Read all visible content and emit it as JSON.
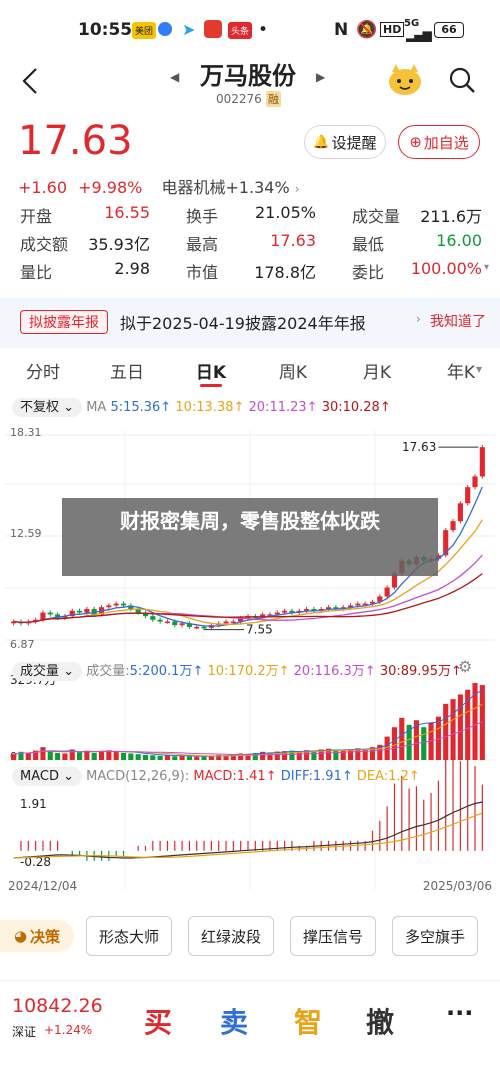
{
  "status_bar": {
    "time": "10:55",
    "app_badges": [
      "美团",
      "头条"
    ],
    "network": "5G",
    "battery": "66"
  },
  "header": {
    "stock_name": "万马股份",
    "stock_code": "002276",
    "margin_tag": "融"
  },
  "quote": {
    "price": "17.63",
    "change": "+1.60",
    "change_pct": "+9.98%",
    "sector": "电器机械+1.34%",
    "alert_label": "设提醒",
    "watch_label": "加自选"
  },
  "stats": [
    [
      {
        "label": "开盘",
        "value": "16.55",
        "color": "#e0282e"
      },
      {
        "label": "换手",
        "value": "21.05%",
        "color": "#222"
      },
      {
        "label": "成交量",
        "value": "211.6万",
        "color": "#222"
      }
    ],
    [
      {
        "label": "成交额",
        "value": "35.93亿",
        "color": "#222"
      },
      {
        "label": "最高",
        "value": "17.63",
        "color": "#e0282e"
      },
      {
        "label": "最低",
        "value": "16.00",
        "color": "#0f9b3a"
      }
    ],
    [
      {
        "label": "量比",
        "value": "2.98",
        "color": "#222"
      },
      {
        "label": "市值",
        "value": "178.8亿",
        "color": "#222"
      },
      {
        "label": "委比",
        "value": "100.00%",
        "color": "#e0282e"
      }
    ]
  ],
  "notice": {
    "tag": "拟披露年报",
    "text": "拟于2025-04-19披露2024年年报",
    "dismiss": "我知道了"
  },
  "tabs": [
    "分时",
    "五日",
    "日K",
    "周K",
    "月K",
    "年K"
  ],
  "active_tab": "日K",
  "chart_controls": {
    "adjust": "不复权",
    "ma_label": "MA",
    "ma5": "5:15.36↑",
    "ma10": "10:13.38↑",
    "ma20": "20:11.23↑",
    "ma30": "30:10.28↑",
    "vol_selector": "成交量",
    "vol_label": "成交量:",
    "vol5": "5:200.1万↑",
    "vol10": "10:170.2万↑",
    "vol20": "20:116.3万↑",
    "vol30": "30:89.95万↑",
    "macd_selector": "MACD",
    "macd_params": "MACD(12,26,9):",
    "macd_value": "MACD:1.41↑",
    "diff_value": "DIFF:1.91↑",
    "dea_value": "DEA:1.2↑"
  },
  "chart_data": {
    "type": "candlestick",
    "y_ticks": [
      "18.31",
      "12.59",
      "6.87"
    ],
    "high_label": "17.63",
    "low_label": "7.55",
    "volume_tick": "329.7万",
    "volume_zero": "0",
    "macd_ticks": [
      "1.91",
      "-0.28"
    ],
    "x_start": "2024/12/04",
    "x_end": "2025/03/06",
    "ylim": [
      6.87,
      18.31
    ],
    "closes": [
      7.9,
      7.8,
      7.9,
      8.0,
      8.4,
      8.3,
      8.1,
      8.2,
      8.5,
      8.4,
      8.6,
      8.3,
      8.7,
      8.8,
      8.9,
      8.8,
      8.6,
      8.4,
      8.2,
      8.0,
      7.9,
      7.9,
      7.7,
      7.8,
      7.6,
      7.6,
      7.55,
      7.7,
      7.8,
      7.9,
      7.9,
      8.1,
      8.2,
      8.1,
      8.3,
      8.3,
      8.4,
      8.5,
      8.4,
      8.5,
      8.6,
      8.5,
      8.6,
      8.7,
      8.6,
      8.7,
      8.8,
      8.9,
      8.9,
      9.0,
      9.3,
      9.8,
      10.6,
      11.3,
      11.1,
      11.5,
      11.3,
      11.4,
      11.6,
      13.0,
      13.5,
      14.5,
      15.4,
      16.0,
      17.63
    ],
    "volumes": [
      25,
      35,
      30,
      40,
      55,
      38,
      30,
      28,
      45,
      33,
      40,
      30,
      38,
      42,
      35,
      30,
      28,
      25,
      22,
      20,
      18,
      20,
      16,
      18,
      15,
      14,
      16,
      18,
      22,
      20,
      25,
      28,
      26,
      30,
      35,
      32,
      36,
      38,
      40,
      35,
      42,
      38,
      45,
      48,
      40,
      44,
      46,
      50,
      48,
      55,
      65,
      100,
      140,
      180,
      150,
      170,
      140,
      160,
      185,
      240,
      260,
      280,
      300,
      329,
      320
    ],
    "macd": [
      -0.28,
      -0.26,
      -0.24,
      -0.22,
      -0.2,
      -0.18,
      -0.16,
      -0.16,
      -0.17,
      -0.18,
      -0.2,
      -0.22,
      -0.24,
      -0.26,
      -0.27,
      -0.28,
      -0.28,
      -0.27,
      -0.26,
      -0.24,
      -0.22,
      -0.2,
      -0.18,
      -0.16,
      -0.14,
      -0.12,
      -0.1,
      -0.08,
      -0.06,
      -0.04,
      -0.02,
      0,
      0.02,
      0.04,
      0.06,
      0.08,
      0.1,
      0.12,
      0.14,
      0.15,
      0.16,
      0.18,
      0.2,
      0.22,
      0.24,
      0.26,
      0.28,
      0.3,
      0.32,
      0.36,
      0.42,
      0.5,
      0.62,
      0.75,
      0.85,
      0.95,
      1.02,
      1.1,
      1.2,
      1.35,
      1.5,
      1.62,
      1.75,
      1.85,
      1.91
    ]
  },
  "headline": "财报密集周，零售股整体收跌",
  "tools": {
    "decision": "决策",
    "items": [
      "形态大师",
      "红绿波段",
      "撑压信号",
      "多空旗手"
    ]
  },
  "index": {
    "value": "10842.26",
    "name": "深证",
    "change": "+1.24%"
  },
  "actions": [
    "买",
    "卖",
    "智",
    "撤"
  ],
  "colors": {
    "up": "#e0282e",
    "down": "#0f9b3a",
    "ma5": "#2f6fd6",
    "ma10": "#e8a317",
    "ma20": "#c050d0",
    "ma30": "#b01818"
  }
}
